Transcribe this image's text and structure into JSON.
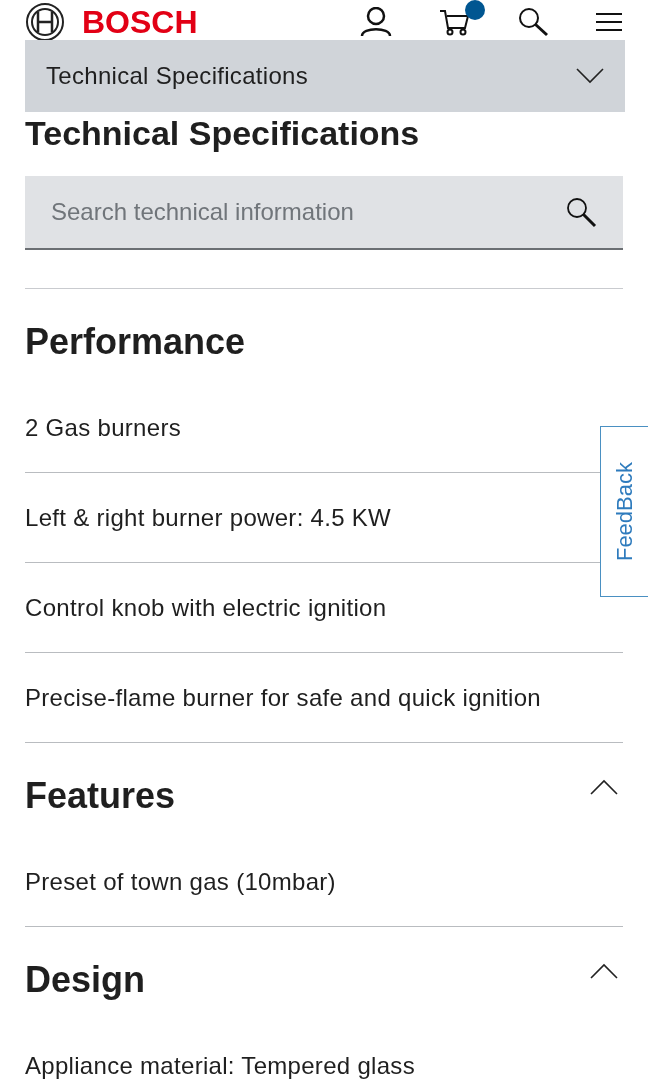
{
  "header": {
    "logo_text": "BOSCH",
    "cart_badge": true
  },
  "section_nav": {
    "label": "Technical Specifications",
    "expanded": false
  },
  "page_title": "Technical Specifications",
  "search": {
    "placeholder": "Search technical information"
  },
  "sections": [
    {
      "title": "Performance",
      "collapsible": false,
      "expanded": true,
      "items": [
        "2 Gas burners",
        "Left & right burner power: 4.5 KW",
        "Control knob with electric ignition",
        "Precise-flame burner for safe and quick ignition"
      ]
    },
    {
      "title": "Features",
      "collapsible": true,
      "expanded": true,
      "items": [
        "Preset of town gas (10mbar)"
      ]
    },
    {
      "title": "Design",
      "collapsible": true,
      "expanded": true,
      "items": [
        "Appliance material: Tempered glass"
      ]
    }
  ],
  "feedback_tab": "FeedBack"
}
